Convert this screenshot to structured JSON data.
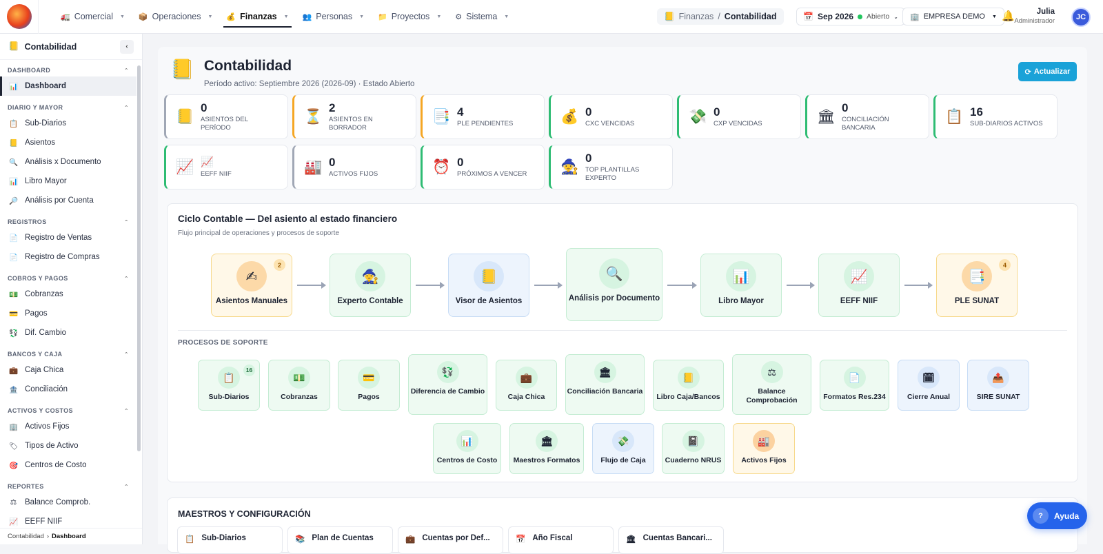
{
  "topnav": {
    "items": [
      {
        "label": "Comercial",
        "icon": "🚛"
      },
      {
        "label": "Operaciones",
        "icon": "📦"
      },
      {
        "label": "Finanzas",
        "icon": "💰"
      },
      {
        "label": "Personas",
        "icon": "👥"
      },
      {
        "label": "Proyectos",
        "icon": "📁"
      },
      {
        "label": "Sistema",
        "icon": "⚙"
      }
    ],
    "breadcrumb": {
      "section": "Finanzas",
      "sep": "/",
      "current": "Contabilidad"
    },
    "period": {
      "label": "Sep 2026",
      "status": "Abierto"
    },
    "company": "EMPRESA DEMO",
    "user": {
      "name": "Julia",
      "role": "Administrador",
      "initials": "JC"
    }
  },
  "sidebar": {
    "title": "Contabilidad",
    "sections": [
      {
        "title": "DASHBOARD",
        "items": [
          {
            "label": "Dashboard",
            "icon": "📊"
          }
        ]
      },
      {
        "title": "DIARIO Y MAYOR",
        "items": [
          {
            "label": "Sub-Diarios",
            "icon": "📋"
          },
          {
            "label": "Asientos",
            "icon": "📒"
          },
          {
            "label": "Análisis x Documento",
            "icon": "🔍"
          },
          {
            "label": "Libro Mayor",
            "icon": "📊"
          },
          {
            "label": "Análisis por Cuenta",
            "icon": "🔎"
          }
        ]
      },
      {
        "title": "REGISTROS",
        "items": [
          {
            "label": "Registro de Ventas",
            "icon": "📄"
          },
          {
            "label": "Registro de Compras",
            "icon": "📄"
          }
        ]
      },
      {
        "title": "COBROS Y PAGOS",
        "items": [
          {
            "label": "Cobranzas",
            "icon": "💵"
          },
          {
            "label": "Pagos",
            "icon": "💳"
          },
          {
            "label": "Dif. Cambio",
            "icon": "💱"
          }
        ]
      },
      {
        "title": "BANCOS Y CAJA",
        "items": [
          {
            "label": "Caja Chica",
            "icon": "💼"
          },
          {
            "label": "Conciliación",
            "icon": "🏦"
          }
        ]
      },
      {
        "title": "ACTIVOS Y COSTOS",
        "items": [
          {
            "label": "Activos Fijos",
            "icon": "🏢"
          },
          {
            "label": "Tipos de Activo",
            "icon": "🏷"
          },
          {
            "label": "Centros de Costo",
            "icon": "🎯"
          }
        ]
      },
      {
        "title": "REPORTES",
        "items": [
          {
            "label": "Balance Comprob.",
            "icon": "⚖"
          },
          {
            "label": "EEFF NIIF",
            "icon": "📈"
          }
        ]
      }
    ],
    "footer": {
      "section": "Contabilidad",
      "sep": "›",
      "current": "Dashboard"
    }
  },
  "page": {
    "icon": "📒",
    "title": "Contabilidad",
    "subtitle": "Período activo: Septiembre 2026 (2026-09) · Estado Abierto",
    "refresh_label": "Actualizar"
  },
  "kpis": [
    {
      "value": "0",
      "label": "ASIENTOS DEL PERÍODO",
      "icon": "📒"
    },
    {
      "value": "2",
      "label": "ASIENTOS EN BORRADOR",
      "icon": "⏳"
    },
    {
      "value": "4",
      "label": "PLE PENDIENTES",
      "icon": "📑"
    },
    {
      "value": "0",
      "label": "CXC VENCIDAS",
      "icon": "💰"
    },
    {
      "value": "0",
      "label": "CXP VENCIDAS",
      "icon": "💸"
    },
    {
      "value": "0",
      "label": "CONCILIACIÓN BANCARIA",
      "icon": "🏛"
    },
    {
      "value": "16",
      "label": "SUB-DIARIOS ACTIVOS",
      "icon": "📋"
    },
    {
      "value": "📈",
      "label": "EEFF NIIF",
      "icon": "📈"
    },
    {
      "value": "0",
      "label": "ACTIVOS FIJOS",
      "icon": "🏭"
    },
    {
      "value": "0",
      "label": "PRÓXIMOS A VENCER",
      "icon": "⏰"
    },
    {
      "value": "0",
      "label": "TOP PLANTILLAS EXPERTO",
      "icon": "🧙"
    }
  ],
  "cycle": {
    "title": "Ciclo Contable — Del asiento al estado financiero",
    "subtitle": "Flujo principal de operaciones y procesos de soporte",
    "nodes": [
      {
        "label": "Asientos Manuales",
        "icon": "✍",
        "badge": "2"
      },
      {
        "label": "Experto Contable",
        "icon": "🧙"
      },
      {
        "label": "Visor de Asientos",
        "icon": "📒"
      },
      {
        "label": "Análisis por Documento",
        "icon": "🔍"
      },
      {
        "label": "Libro Mayor",
        "icon": "📊"
      },
      {
        "label": "EEFF NIIF",
        "icon": "📈"
      },
      {
        "label": "PLE SUNAT",
        "icon": "📑",
        "badge": "4"
      }
    ],
    "support_title": "PROCESOS DE SOPORTE",
    "support": [
      {
        "label": "Sub-Diarios",
        "icon": "📋",
        "badge": "16"
      },
      {
        "label": "Cobranzas",
        "icon": "💵"
      },
      {
        "label": "Pagos",
        "icon": "💳"
      },
      {
        "label": "Diferencia de Cambio",
        "icon": "💱"
      },
      {
        "label": "Caja Chica",
        "icon": "💼"
      },
      {
        "label": "Conciliación Bancaria",
        "icon": "🏛"
      },
      {
        "label": "Libro Caja/Bancos",
        "icon": "📒"
      },
      {
        "label": "Balance Comprobación",
        "icon": "⚖"
      },
      {
        "label": "Formatos Res.234",
        "icon": "📄"
      },
      {
        "label": "Cierre Anual",
        "icon": "🗓"
      },
      {
        "label": "SIRE SUNAT",
        "icon": "📤"
      },
      {
        "label": "Centros de Costo",
        "icon": "📊"
      },
      {
        "label": "Maestros Formatos",
        "icon": "🏛"
      },
      {
        "label": "Flujo de Caja",
        "icon": "💸"
      },
      {
        "label": "Cuaderno NRUS",
        "icon": "📓"
      },
      {
        "label": "Activos Fijos",
        "icon": "🏭"
      }
    ]
  },
  "maestros": {
    "title": "MAESTROS Y CONFIGURACIÓN",
    "cards": [
      {
        "label": "Sub-Diarios",
        "icon": "📋"
      },
      {
        "label": "Plan de Cuentas",
        "icon": "📚"
      },
      {
        "label": "Cuentas por Def...",
        "icon": "💼"
      },
      {
        "label": "Año Fiscal",
        "icon": "📅"
      },
      {
        "label": "Cuentas Bancari...",
        "icon": "🏛"
      }
    ]
  },
  "help_label": "Ayuda"
}
